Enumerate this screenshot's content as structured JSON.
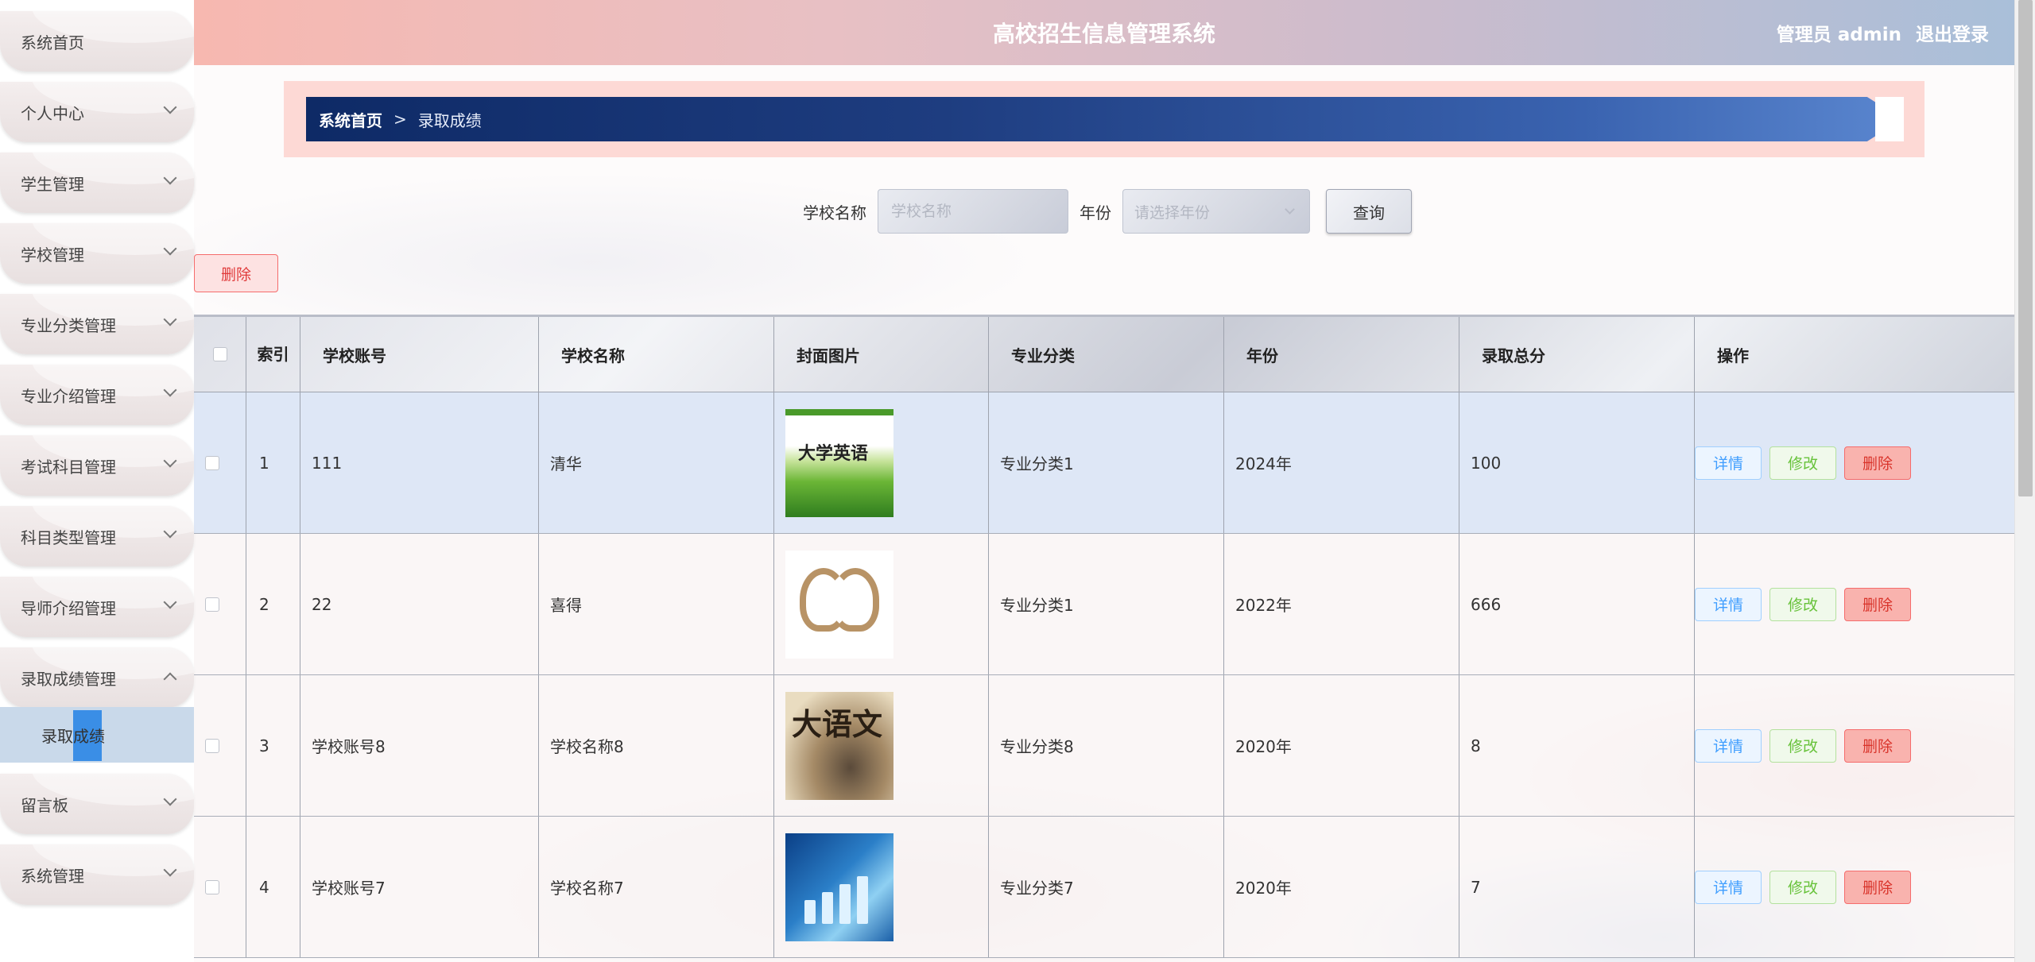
{
  "app": {
    "title": "高校招生信息管理系统",
    "user_label": "管理员 admin",
    "logout": "退出登录"
  },
  "sidebar": {
    "items": [
      {
        "label": "系统首页"
      },
      {
        "label": "个人中心"
      },
      {
        "label": "学生管理"
      },
      {
        "label": "学校管理"
      },
      {
        "label": "专业分类管理"
      },
      {
        "label": "专业介绍管理"
      },
      {
        "label": "考试科目管理"
      },
      {
        "label": "科目类型管理"
      },
      {
        "label": "导师介绍管理"
      },
      {
        "label": "录取成绩管理"
      },
      {
        "label": "留言板"
      },
      {
        "label": "系统管理"
      }
    ],
    "active_sub": "录取成绩"
  },
  "breadcrumb": {
    "home": "系统首页",
    "sep": ">",
    "current": "录取成绩"
  },
  "search": {
    "school_label": "学校名称",
    "school_placeholder": "学校名称",
    "year_label": "年份",
    "year_placeholder": "请选择年份",
    "query_button": "查询"
  },
  "toolbar": {
    "delete_label": "删除"
  },
  "table": {
    "headers": [
      "",
      "索引",
      "学校账号",
      "学校名称",
      "封面图片",
      "专业分类",
      "年份",
      "录取总分",
      "操作"
    ],
    "rows": [
      {
        "index": "1",
        "account": "111",
        "name": "清华",
        "category": "专业分类1",
        "year": "2024年",
        "score": "100",
        "cover_text": "大学英语"
      },
      {
        "index": "2",
        "account": "22",
        "name": "喜得",
        "category": "专业分类1",
        "year": "2022年",
        "score": "666",
        "cover_text": ""
      },
      {
        "index": "3",
        "account": "学校账号8",
        "name": "学校名称8",
        "category": "专业分类8",
        "year": "2020年",
        "score": "8",
        "cover_text": "大语文"
      },
      {
        "index": "4",
        "account": "学校账号7",
        "name": "学校名称7",
        "category": "专业分类7",
        "year": "2020年",
        "score": "7",
        "cover_text": ""
      }
    ],
    "actions": {
      "view": "详情",
      "edit": "修改",
      "delete": "删除"
    }
  },
  "colors": {
    "header_gradient_start": "#f7b8b0",
    "header_gradient_end": "#a9bfd9",
    "breadcrumb_bg": "#0e2a66",
    "active_highlight": "#3a8ee6"
  }
}
